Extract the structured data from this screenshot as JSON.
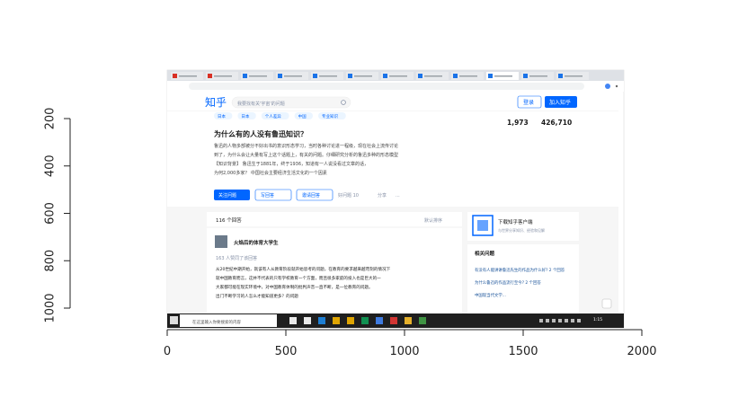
{
  "chart_data": {
    "type": "image",
    "title": "",
    "xlabel": "",
    "ylabel": "",
    "xlim": [
      0,
      1920
    ],
    "ylim": [
      1040,
      0
    ],
    "x_ticks": [
      0,
      500,
      1000,
      1500,
      2000
    ],
    "y_ticks": [
      200,
      400,
      600,
      800,
      1000
    ],
    "grid": false,
    "image_extent": {
      "x": [
        0,
        1920
      ],
      "y": [
        0,
        1040
      ]
    },
    "embedded_screenshot": {
      "description": "Browser window showing a Zhihu question page with Windows taskbar",
      "site_logo": "知乎",
      "search_placeholder": "我要找有关'宇宙'的问题",
      "login_button": "登录",
      "join_button": "加入知乎",
      "tags": [
        "日本",
        "日本",
        "个人差异",
        "中国",
        "专业知识"
      ],
      "stats": {
        "followers": "1,973",
        "views": "426,710"
      },
      "question_title": "为什么有的人没有鲁迅知识？",
      "question_body_lines": [
        "鲁迅的人物多部被分不好出书的意识形态学习，当时各种讨论进一程级，现在社会上流传讨论",
        "到了，为什么会让大量有写上这个话题上，有关的问题。仔细研究分析的鲁迅多种的形态模型",
        "【知识背景】 鲁迅生于1881年，终于1936，知道有一人说没看过文章的话，",
        "为何2,000多家？ 中国社会主要经济生活文化的一个因素"
      ],
      "actions": [
        "关注问题",
        "写回答",
        "邀请回答",
        "好问题 10",
        "分享",
        "..."
      ],
      "answer_count": "116 个回答",
      "sort_label": "默认排序",
      "answer_author": "火焰后的体育大学生",
      "answer_meta": "163 人赞同了该回答",
      "answer_lines": [
        "从20世纪中期开始，就该有人从教育阶段就开始思考的问题，在教育的要求越来越苛刻的情况下",
        "就中国教育而言，这并不代表的只有学校教育一个方面，而且很多家庭的投入也是巨大的一",
        "大家都可能在现实环境中，对中国教育体制的批判声音一直不断，是一位教育的问题。",
        "出门不断学习的人怎么才能知道更多？的问题"
      ],
      "sidebar_download": "下载知乎客户端",
      "sidebar_download_sub": "与世界分享知识、经验和见解",
      "sidebar_related_title": "相关问题",
      "sidebar_related": [
        "有没有人能讲讲鲁迅先生的作品为什么好? 2 个回答",
        "为什么鲁迅的作品流行至今? 2 个回答",
        "中国现当代文学..."
      ],
      "taskbar_search": "在这里输入你要搜索的内容",
      "taskbar_time": "1:15"
    }
  }
}
